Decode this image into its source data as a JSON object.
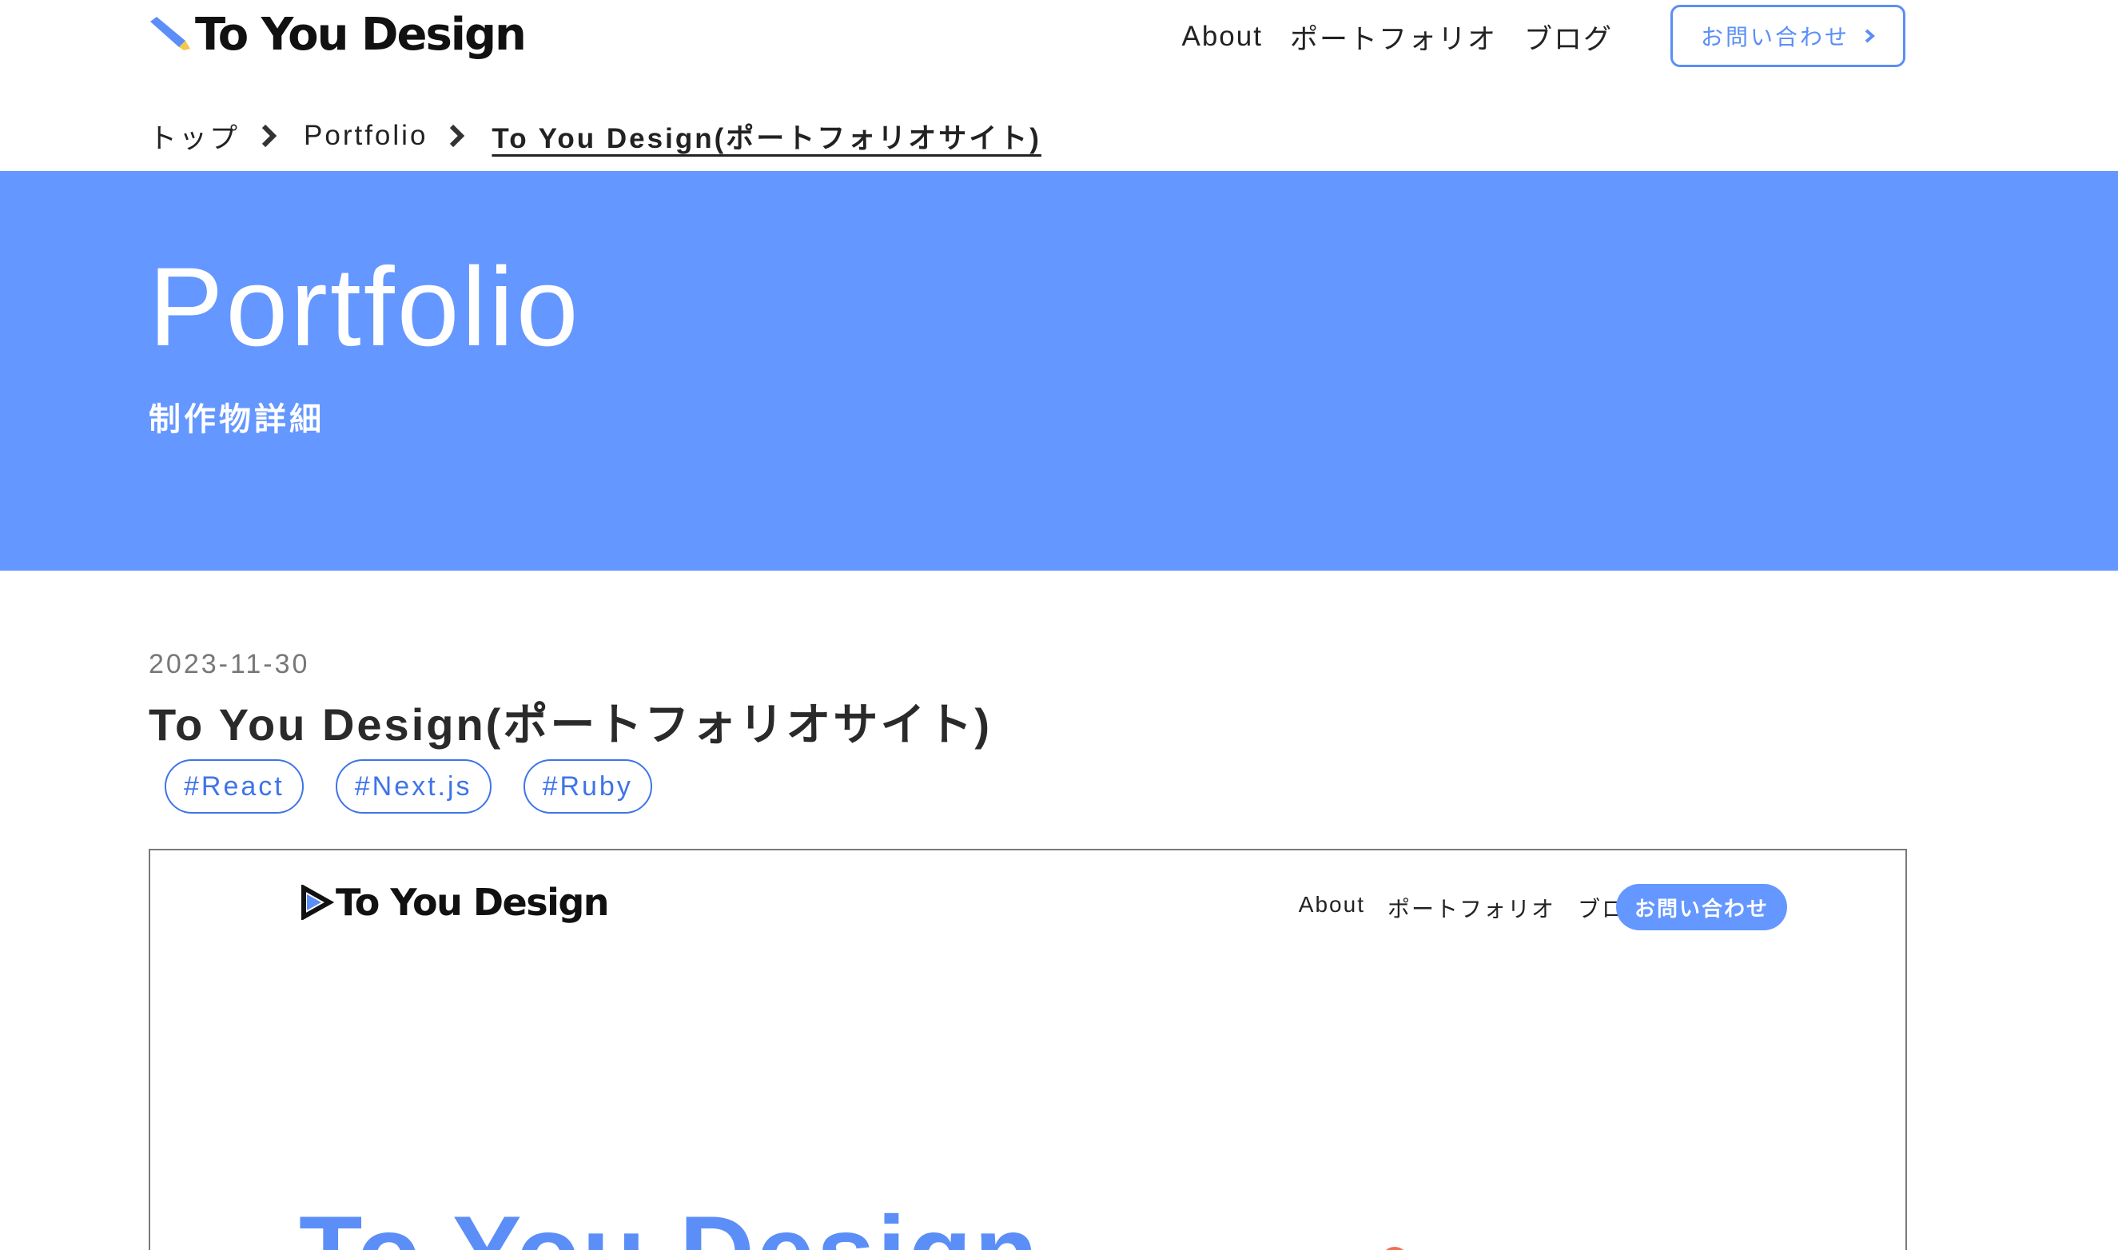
{
  "header": {
    "logo_text": "To You Design",
    "nav": [
      "About",
      "ポートフォリオ",
      "ブログ"
    ],
    "contact_label": "お問い合わせ"
  },
  "breadcrumb": {
    "items": [
      "トップ",
      "Portfolio",
      "To You Design(ポートフォリオサイト)"
    ]
  },
  "hero": {
    "title": "Portfolio",
    "subtitle": "制作物詳細"
  },
  "article": {
    "date": "2023-11-30",
    "title": "To You Design(ポートフォリオサイト)",
    "tags": [
      "#React",
      "#Next.js",
      "#Ruby"
    ]
  },
  "screenshot": {
    "logo_text": "To You Design",
    "nav": [
      "About",
      "ポートフォリオ",
      "ブログ"
    ],
    "contact_label": "お問い合わせ",
    "hero_text": "To You Design"
  },
  "colors": {
    "accent": "#6497ff",
    "link_border": "#5b8ef7",
    "tag": "#3f74e8"
  },
  "icons": [
    "pencil-icon",
    "chevron-right-icon",
    "play-logo-icon"
  ]
}
